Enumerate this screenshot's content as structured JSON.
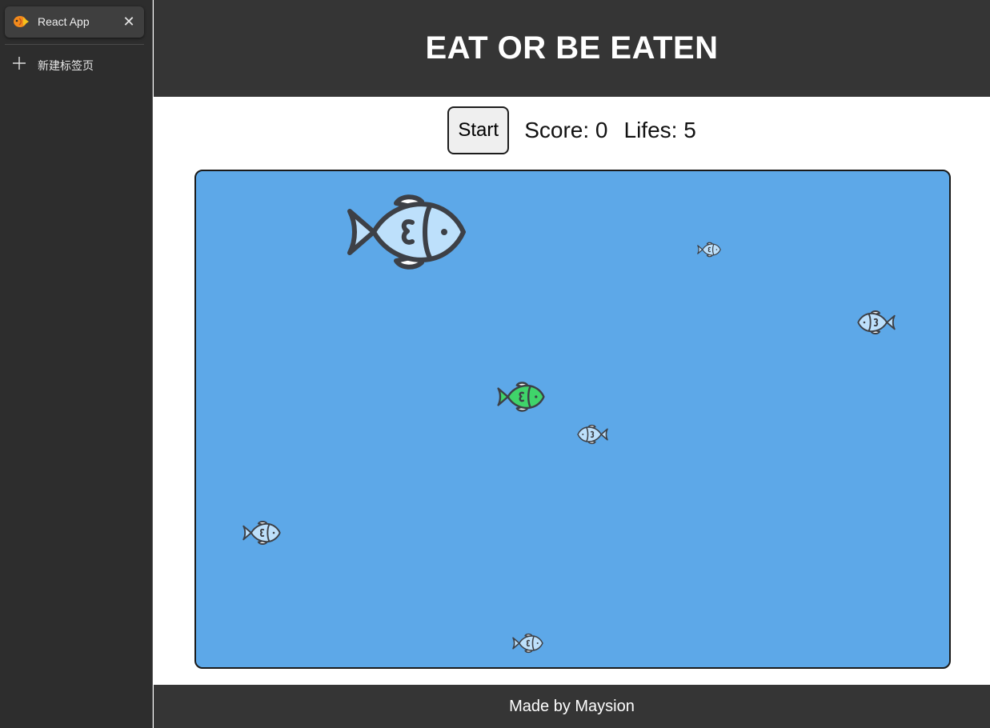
{
  "browser": {
    "active_tab": {
      "title": "React App",
      "icon": "fish-favicon-icon",
      "close_icon": "close-icon"
    },
    "new_tab": {
      "label": "新建标签页",
      "icon": "plus-icon"
    }
  },
  "game": {
    "title": "EAT OR BE EATEN",
    "start_label": "Start",
    "score_text": "Score: 0",
    "lifes_text": "Lifes: 5",
    "player_fish_color": "#3fd46a",
    "enemy_fish_color": "#bde0fb",
    "pond_color": "#5da8e8",
    "fish": [
      {
        "name": "enemy-fish-large",
        "role": "enemy",
        "facing": "right"
      },
      {
        "name": "enemy-fish-tiny",
        "role": "enemy",
        "facing": "right"
      },
      {
        "name": "enemy-fish-right",
        "role": "enemy",
        "facing": "left"
      },
      {
        "name": "player-fish",
        "role": "player",
        "facing": "right"
      },
      {
        "name": "enemy-fish-center",
        "role": "enemy",
        "facing": "left"
      },
      {
        "name": "enemy-fish-left",
        "role": "enemy",
        "facing": "right"
      },
      {
        "name": "enemy-fish-bottom",
        "role": "enemy",
        "facing": "right"
      }
    ]
  },
  "footer": {
    "text": "Made by Maysion"
  }
}
